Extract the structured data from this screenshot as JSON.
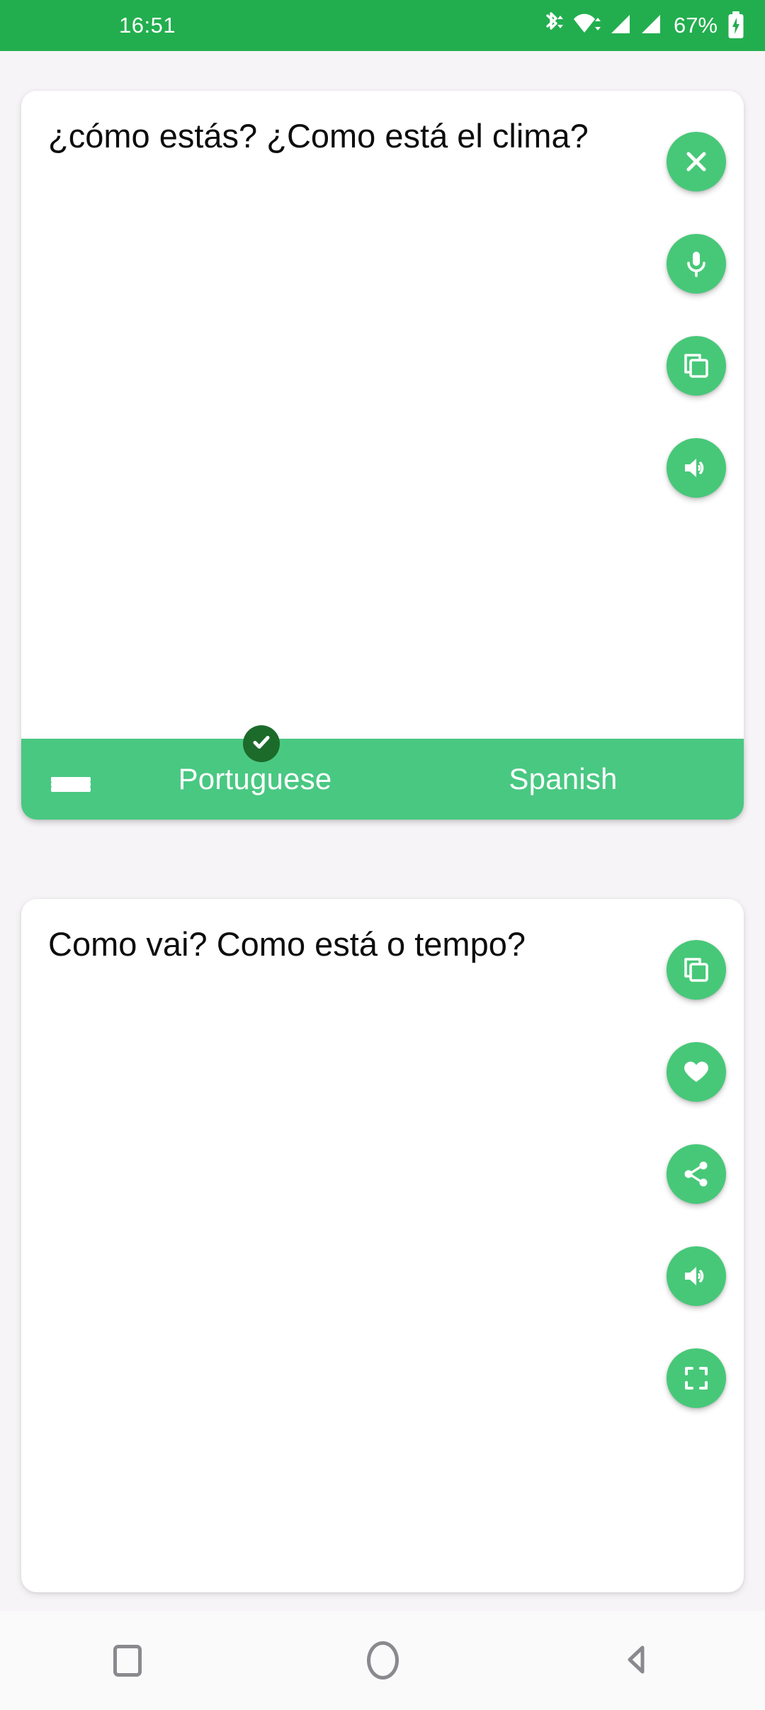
{
  "status_bar": {
    "time": "16:51",
    "battery_percent": "67%",
    "icons": [
      "bluetooth-icon",
      "wifi-icon",
      "signal-sim1-icon",
      "signal-sim2-icon",
      "battery-charging-icon"
    ],
    "background_color": "#22ae4e",
    "foreground_color": "#ffffff"
  },
  "source_card": {
    "text": "¿cómo estás? ¿Como está el clima?",
    "buttons": [
      {
        "name": "clear-button",
        "icon": "close-icon"
      },
      {
        "name": "microphone-button",
        "icon": "microphone-icon"
      },
      {
        "name": "copy-button",
        "icon": "copy-icon"
      },
      {
        "name": "speak-button",
        "icon": "speaker-icon"
      }
    ]
  },
  "language_bar": {
    "menu_icon": "hamburger-menu-icon",
    "target_language": "Portuguese",
    "source_language": "Spanish",
    "check_icon": "check-icon",
    "background_color": "#49c882",
    "check_badge_color": "#1c6b2b"
  },
  "target_card": {
    "text": "Como vai? Como está o tempo?",
    "buttons": [
      {
        "name": "copy-button",
        "icon": "copy-icon"
      },
      {
        "name": "favorite-button",
        "icon": "heart-icon"
      },
      {
        "name": "share-button",
        "icon": "share-icon"
      },
      {
        "name": "speak-button",
        "icon": "speaker-icon"
      },
      {
        "name": "fullscreen-button",
        "icon": "fullscreen-icon"
      }
    ]
  },
  "navigation_bar": {
    "recents": "square-icon",
    "home": "circle-icon",
    "back": "triangle-back-icon"
  },
  "theme": {
    "accent": "#47c878",
    "page_background": "#f6f4f6",
    "card_background": "#ffffff",
    "text_color": "#0d0d0d"
  }
}
